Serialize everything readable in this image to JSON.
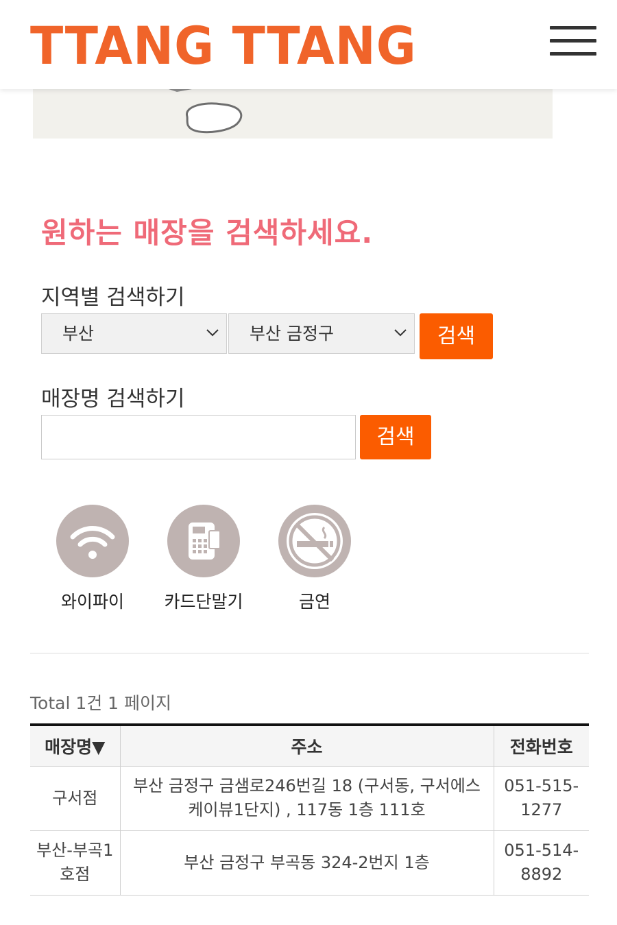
{
  "header": {
    "logo": "TTANG TTANG",
    "menu_icon": "hamburger-icon"
  },
  "search": {
    "title": "원하는 매장을 검색하세요.",
    "region_label": "지역별 검색하기",
    "region_select": "부산",
    "district_select": "부산 금정구",
    "search_button": "검색",
    "store_label": "매장명 검색하기",
    "store_input_value": "",
    "store_search_button": "검색"
  },
  "amenities": [
    {
      "label": "와이파이",
      "icon": "wifi-icon"
    },
    {
      "label": "카드단말기",
      "icon": "card-terminal-icon"
    },
    {
      "label": "금연",
      "icon": "no-smoking-icon"
    }
  ],
  "results": {
    "total_text": "Total 1건 1 페이지",
    "columns": [
      "매장명▼",
      "주소",
      "전화번호"
    ],
    "rows": [
      {
        "name": "구서점",
        "address": "부산 금정구 금샘로246번길 18 (구서동, 구서에스케이뷰1단지) , 117동 1층 111호",
        "phone": "051-515-1277"
      },
      {
        "name": "부산-부곡1호점",
        "address": "부산 금정구 부곡동 324-2번지 1층",
        "phone": "051-514-8892"
      }
    ]
  },
  "colors": {
    "brand": "#f0642a",
    "accent_button": "#fb5c00",
    "title_pink": "#ef6a78",
    "amenity_gray": "#bfb3b1"
  }
}
